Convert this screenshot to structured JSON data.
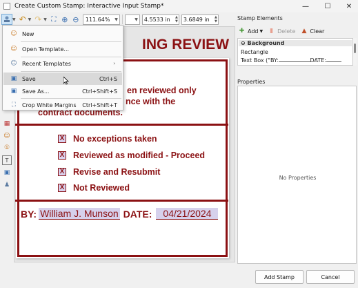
{
  "window": {
    "title": "Create Custom Stamp: Interactive Input Stamp*",
    "minimize": "—",
    "maximize": "☐",
    "close": "✕"
  },
  "toolbar": {
    "zoom": "111.64%",
    "width_in": "4.5533 in",
    "height_in": "3.6849 in"
  },
  "menu": {
    "items": [
      {
        "label": "New",
        "shortcut": "",
        "icon": "new-icon"
      },
      {
        "label": "Open Template...",
        "shortcut": "",
        "icon": "open-template-icon"
      },
      {
        "label": "Recent Templates",
        "shortcut": "",
        "icon": "recent-templates-icon",
        "submenu": true
      },
      {
        "label": "Save",
        "shortcut": "Ctrl+S",
        "icon": "save-icon"
      },
      {
        "label": "Save As...",
        "shortcut": "Ctrl+Shift+S",
        "icon": "save-as-icon"
      },
      {
        "label": "Crop White Margins",
        "shortcut": "Ctrl+Shift+T",
        "icon": "crop-icon"
      }
    ]
  },
  "stamp": {
    "title_fragment": "ING REVIEW",
    "line1": "en reviewed only",
    "line2": "nce with the",
    "line3": "contract documents.",
    "checks": [
      {
        "mark": "X",
        "label": "No exceptions taken"
      },
      {
        "mark": "X",
        "label": "Reviewed as modified - Proceed"
      },
      {
        "mark": "X",
        "label": "Revise and Resubmit"
      },
      {
        "mark": "X",
        "label": "Not Reviewed"
      }
    ],
    "by_label": "BY:",
    "by_value": "William J. Munson",
    "date_label": "DATE:",
    "date_value": "04/21/2024",
    "color": "#8b1113"
  },
  "right_panel": {
    "stamp_elements_title": "Stamp Elements",
    "add_label": "Add",
    "delete_label": "Delete",
    "clear_label": "Clear",
    "elements": [
      "Background",
      "Rectangle",
      "Text Box (\"BY:",
      "DATE:"
    ],
    "properties_title": "Properties",
    "no_properties": "No Properties"
  },
  "footer": {
    "add_stamp": "Add Stamp",
    "cancel": "Cancel"
  }
}
